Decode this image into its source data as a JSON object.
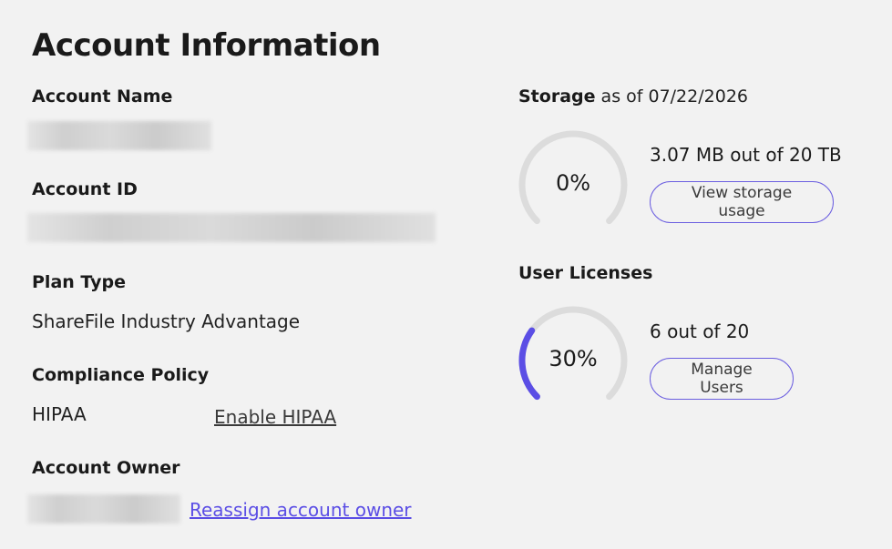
{
  "page": {
    "title": "Account Information"
  },
  "account_name": {
    "label": "Account Name"
  },
  "account_id": {
    "label": "Account ID"
  },
  "plan_type": {
    "label": "Plan Type",
    "value": "ShareFile Industry Advantage"
  },
  "compliance": {
    "label": "Compliance Policy",
    "value": "HIPAA",
    "action": "Enable HIPAA"
  },
  "account_owner": {
    "label": "Account Owner",
    "action": "Reassign account owner"
  },
  "storage": {
    "label": "Storage",
    "as_of": "as of 07/22/2026",
    "percent_label": "0%",
    "percent": 0,
    "usage": "3.07 MB out of 20 TB",
    "button": "View storage usage"
  },
  "licenses": {
    "label": "User Licenses",
    "percent_label": "30%",
    "percent": 30,
    "usage": "6 out of 20",
    "button": "Manage Users"
  },
  "colors": {
    "accent": "#5b4ee5",
    "gauge_track": "#dcdcdc",
    "background": "#f2f2f2"
  }
}
